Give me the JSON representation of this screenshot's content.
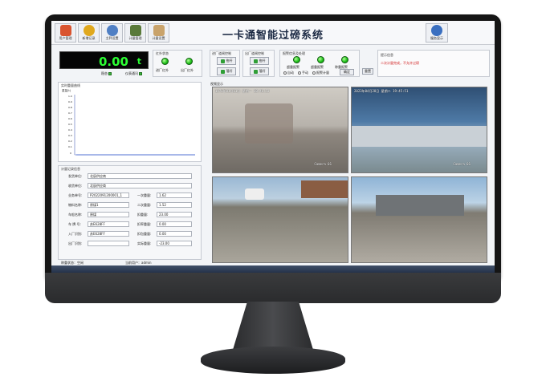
{
  "toolbar": {
    "buttons": [
      {
        "label": "用户管理",
        "icon": "users-icon",
        "color": "#d9542f"
      },
      {
        "label": "新增记录",
        "icon": "search-record-icon",
        "color": "#e0a81d"
      },
      {
        "label": "主秤设置",
        "icon": "gear-icon",
        "color": "#4f7fc4"
      },
      {
        "label": "计量管理",
        "icon": "scale-icon",
        "color": "#5a7a3a"
      },
      {
        "label": "计量设置",
        "icon": "settings-tools-icon",
        "color": "#c9a36b"
      }
    ],
    "title": "一卡通智能过磅系统",
    "system_button": {
      "label": "服务显示",
      "icon": "people-icon"
    }
  },
  "weight": {
    "value": "0.00",
    "unit": "t",
    "stable_label": "稳态",
    "status_label": "仪表通讯"
  },
  "switches": {
    "title": "红外状态",
    "left": "进厂红外",
    "right": "出厂红外"
  },
  "gate_in": {
    "title": "进厂道闸控制",
    "open": "抬杆",
    "close": "落杆"
  },
  "gate_out": {
    "title": "出厂道闸控制",
    "open": "抬杆",
    "close": "落杆"
  },
  "alarm": {
    "title": "报警信息及处理",
    "items": [
      "超重报警",
      "超重报警",
      "称重报警"
    ],
    "radios": [
      "自动",
      "手动",
      "报警计量"
    ],
    "confirm": "确定",
    "reset": "重置"
  },
  "notice": {
    "title": "提示信息",
    "text": "二次计量完成，不允许过磅"
  },
  "trend": {
    "title": "实时重量曲线",
    "ylabel": "重量(t)",
    "yticks": [
      "1.0",
      "0.9",
      "0.8",
      "0.7",
      "0.6",
      "0.5",
      "0.4",
      "0.3",
      "0.2",
      "0.1",
      "0"
    ]
  },
  "record": {
    "title": "计量记录信息",
    "shipper_label": "发货单位:",
    "shipper_value": "北辰供应商",
    "receiver_label": "收货单位:",
    "receiver_value": "北辰供应商",
    "order_label": "业务单号:",
    "order_value": "P2022091200001_1",
    "material_label": "物料名称:",
    "material_value": "原煤1",
    "vehicle_label": "车船名称:",
    "vehicle_value": "原煤",
    "car_label": "车   牌   号:",
    "car_value": "苏E628FF",
    "entry_label": "入厂识别:",
    "entry_value": "苏E628FF",
    "exit_label": "出厂识别:",
    "exit_value": "",
    "first_label": "一次重量:",
    "first_value": "1.62",
    "second_label": "二次重量:",
    "second_value": "1.52",
    "deduct_label": "扣重量:",
    "deduct_value": "23.00",
    "discount_label": "扣率重量:",
    "discount_value": "0.00",
    "pack_label": "扣包重量:",
    "pack_value": "0.00",
    "net_label": "实际重量:",
    "net_value": "-23.00"
  },
  "status": {
    "left": "称重状态：空闲",
    "right": "当前用户：admin"
  },
  "video": {
    "title": "视频显示",
    "cams": [
      {
        "timestamp": "1970年01月01日  星期一  00:46:53",
        "name": "Camera 01"
      },
      {
        "timestamp": "2023年04月28日  星期二  19:45:51",
        "name": "Camera 01"
      },
      {
        "timestamp": "",
        "name": ""
      },
      {
        "timestamp": "",
        "name": ""
      }
    ]
  }
}
